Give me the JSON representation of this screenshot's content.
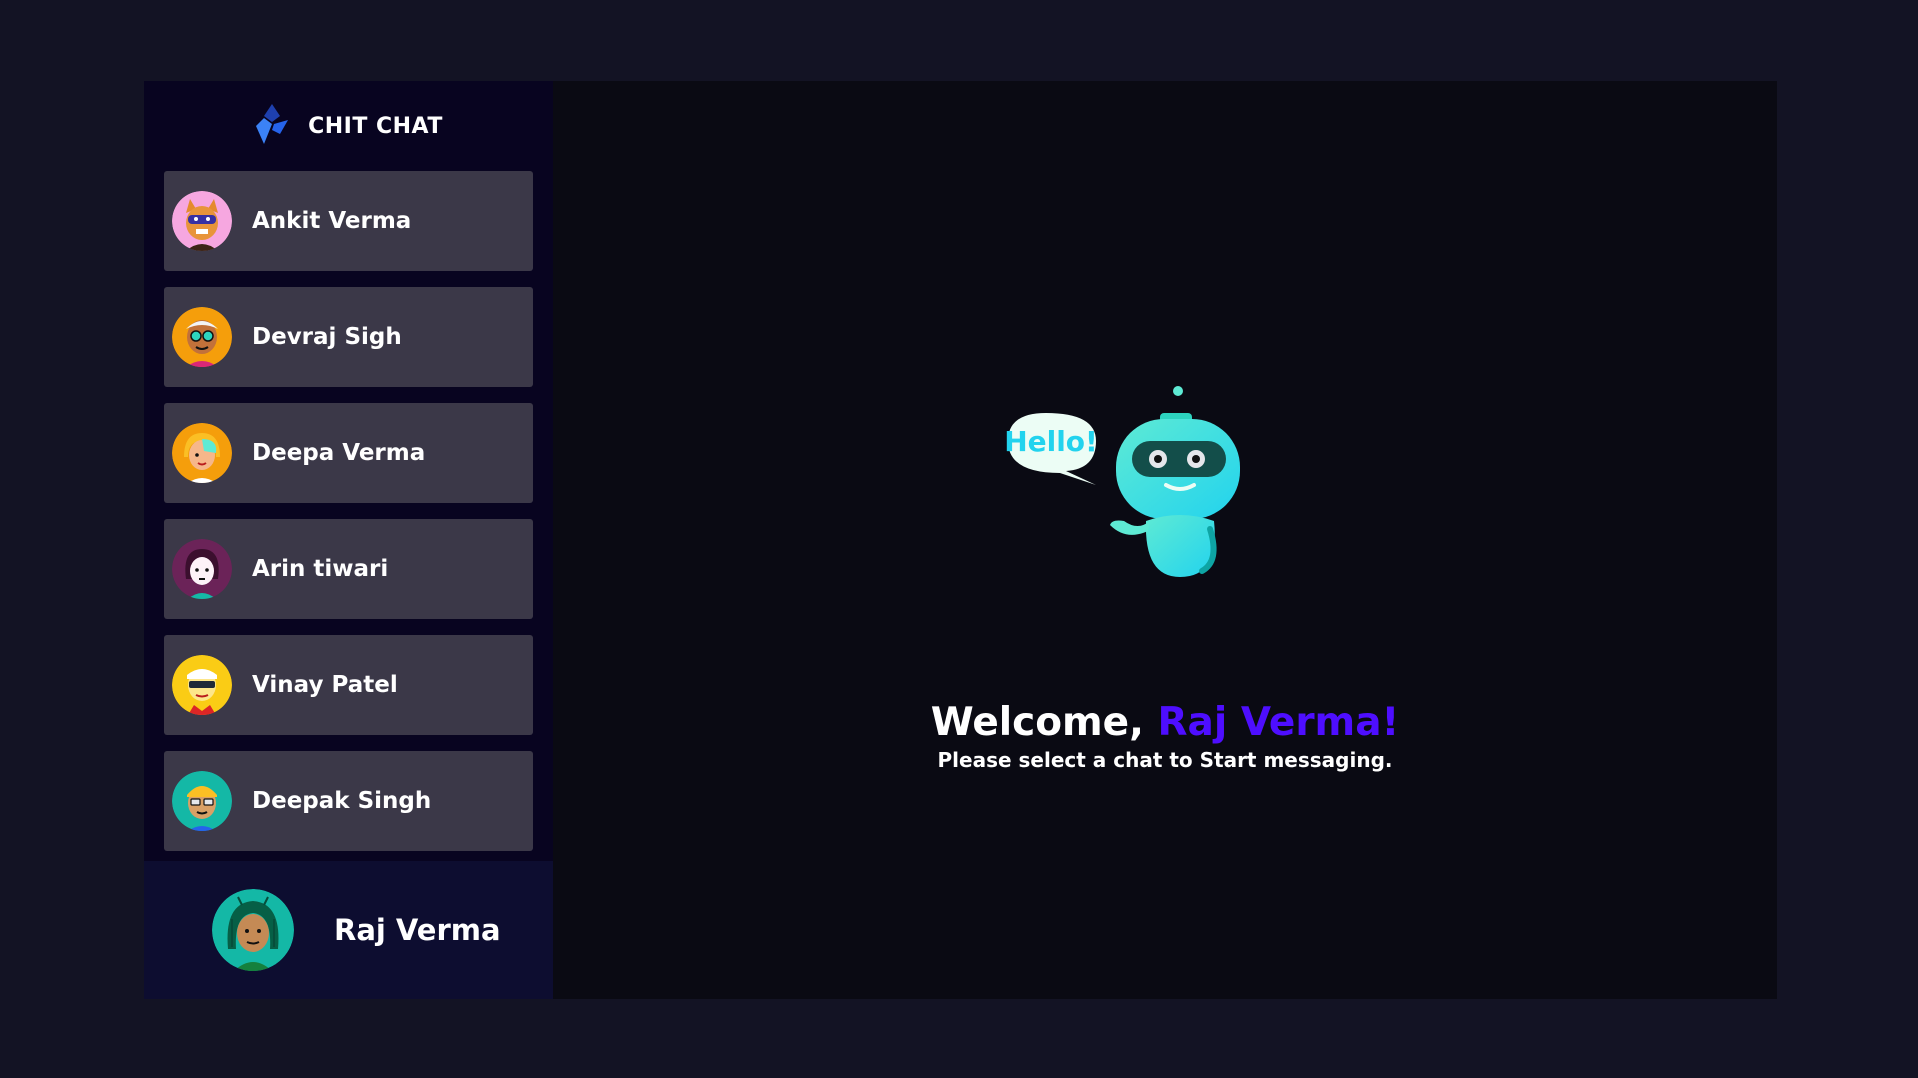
{
  "brand": {
    "title": "CHIT CHAT",
    "icon": "diamond-logo-icon",
    "color": "#2563eb"
  },
  "contacts": [
    {
      "name": "Ankit Verma",
      "avatar": "avatar-pink-mask",
      "bg": "#f6a7e0"
    },
    {
      "name": "Devraj Sigh",
      "avatar": "avatar-orange-glasses",
      "bg": "#f59e0b"
    },
    {
      "name": "Deepa Verma",
      "avatar": "avatar-orange-blonde",
      "bg": "#f59e0b"
    },
    {
      "name": "Arin tiwari",
      "avatar": "avatar-purple-dark-hair",
      "bg": "#6b2358"
    },
    {
      "name": "Vinay Patel",
      "avatar": "avatar-yellow-sunglasses",
      "bg": "#facc15"
    },
    {
      "name": "Deepak Singh",
      "avatar": "avatar-teal-glasses",
      "bg": "#14b8a6"
    }
  ],
  "current_user": {
    "name": "Raj Verma",
    "avatar": "avatar-teal-dreadlocks",
    "bg": "#14b8a6"
  },
  "welcome": {
    "greeting": "Welcome, ",
    "user": "Raj Verma!",
    "subtitle": "Please select a chat to Start messaging.",
    "accent": "#4e0eff"
  },
  "illustration": {
    "speech_bubble": "Hello!",
    "icon": "robot-icon"
  }
}
